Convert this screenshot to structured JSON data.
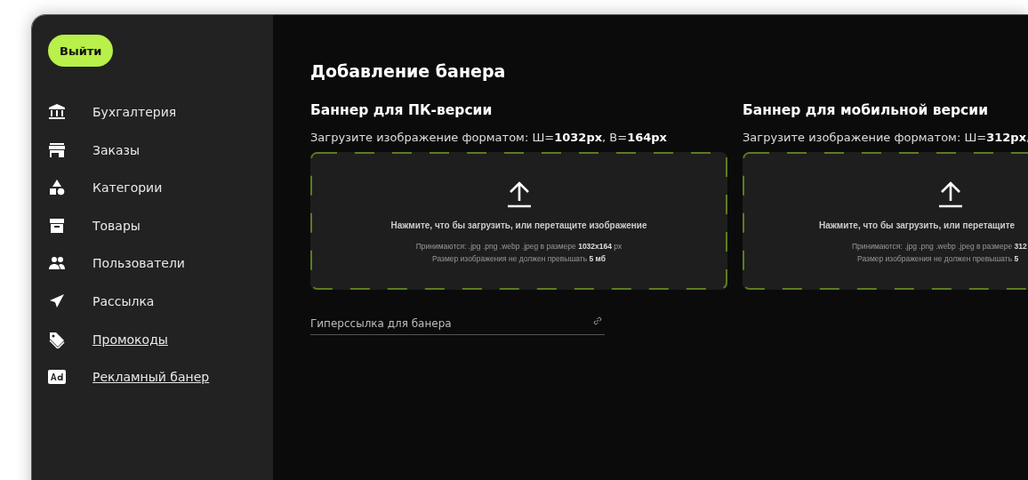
{
  "sidebar": {
    "logout_button": "Выйти",
    "items": [
      {
        "label": "Бухгалтерия",
        "underlined": false
      },
      {
        "label": "Заказы",
        "underlined": false
      },
      {
        "label": "Категории",
        "underlined": false
      },
      {
        "label": "Товары",
        "underlined": false
      },
      {
        "label": "Пользователи",
        "underlined": false
      },
      {
        "label": "Рассылка",
        "underlined": false
      },
      {
        "label": "Промокоды",
        "underlined": true
      },
      {
        "label": "Рекламный банер",
        "underlined": true
      }
    ]
  },
  "page_title": "Добавление банера",
  "banners": [
    {
      "title": "Баннер для ПК-версии",
      "hint": "Загрузите изображение форматом: Ш=**1032px**, В=**164px**",
      "dropzone": {
        "prompt": "Нажмите, что бы загрузить, или перетащите изображение",
        "formats": "Принимаются: .jpg .png .webp .jpeg в размере **1032x164** px",
        "size_limit": "Размер изображения не должен превышать **5 мб**"
      }
    },
    {
      "title": "Баннер для мобильной версии",
      "hint": "Загрузите изображение форматом: Ш=**312px**,",
      "dropzone": {
        "prompt": "Нажмите, что бы загрузить, или перетащите",
        "formats": "Принимаются: .jpg .png .webp .jpeg в размере **312**",
        "size_limit": "Размер изображения не должен превышать **5**"
      }
    }
  ],
  "link_field": {
    "placeholder": "Гиперссылка для банера"
  }
}
